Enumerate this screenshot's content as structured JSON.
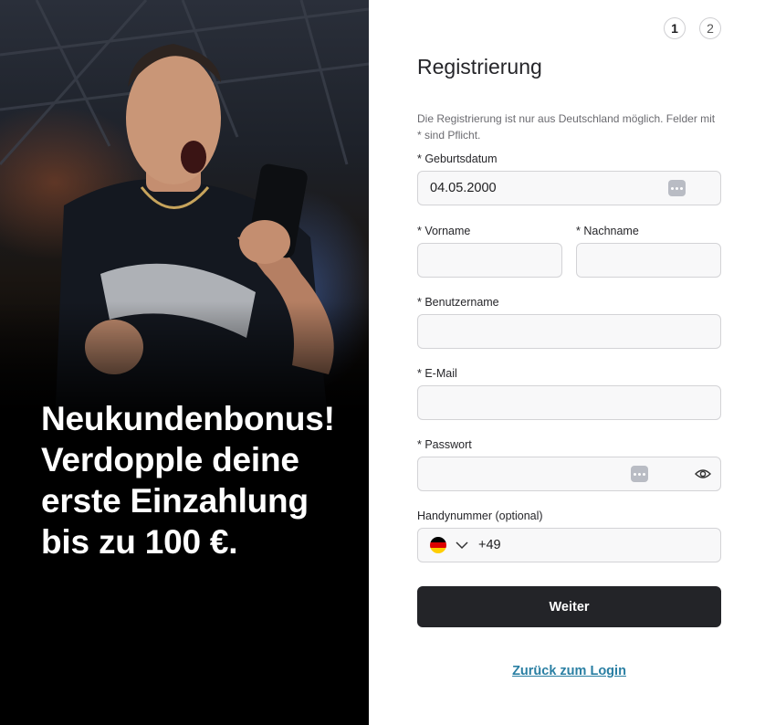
{
  "promo": {
    "line1": "Neukundenbonus!",
    "line2": "Verdopple deine",
    "line3": "erste Einzahlung",
    "line4": "bis zu 100 €."
  },
  "steps": [
    {
      "label": "1",
      "active": true
    },
    {
      "label": "2",
      "active": false
    }
  ],
  "form": {
    "title": "Registrierung",
    "note": "Die Registrierung ist nur aus Deutschland möglich. Felder mit * sind Pflicht.",
    "birthdate_label": "* Geburtsdatum",
    "birthdate_value": "04.05.2000",
    "firstname_label": "* Vorname",
    "firstname_value": "",
    "lastname_label": "* Nachname",
    "lastname_value": "",
    "username_label": "* Benutzername",
    "username_value": "",
    "email_label": "* E-Mail",
    "email_value": "",
    "password_label": "* Passwort",
    "password_value": "",
    "phone_label": "Handynummer (optional)",
    "phone_country_icon": "germany-flag-icon",
    "phone_code": "+49",
    "submit_label": "Weiter",
    "back_link": "Zurück zum Login"
  },
  "colors": {
    "button_bg": "#232428",
    "link": "#2a7fa3",
    "field_bg": "#f8f8f9",
    "field_border": "#d3d3d6"
  }
}
